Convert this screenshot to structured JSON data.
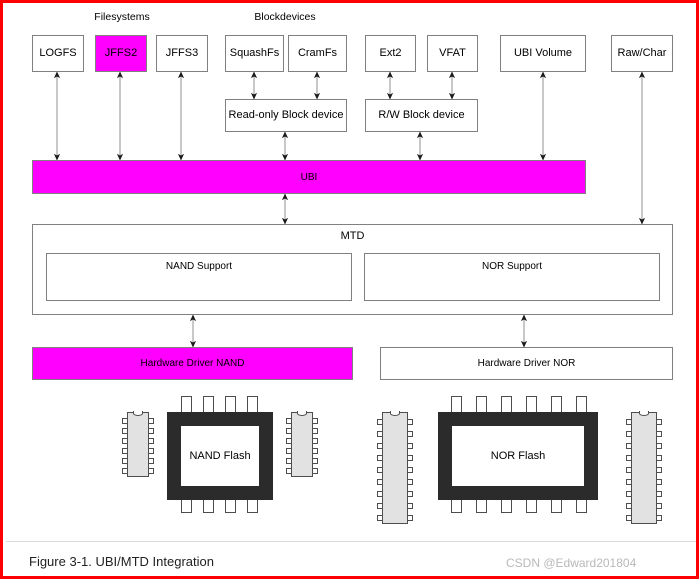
{
  "figure": {
    "caption": "Figure 3-1. UBI/MTD Integration",
    "watermark": "CSDN @Edward201804",
    "border_color": "#ff0000",
    "accent_color": "#ff00ff"
  },
  "group_labels": {
    "filesystems": "Filesystems",
    "blockdevices": "Blockdevices"
  },
  "nodes": {
    "logfs": "LOGFS",
    "jffs2": "JFFS2",
    "jffs3": "JFFS3",
    "squashfs": "SquashFs",
    "cramfs": "CramFs",
    "ext2": "Ext2",
    "vfat": "VFAT",
    "ubi_volume": "UBI Volume",
    "raw_char": "Raw/Char",
    "readonly_block": "Read-only Block device",
    "rw_block": "R/W Block device",
    "ubi": "UBI",
    "mtd": "MTD",
    "nand_support": "NAND Support",
    "nor_support": "NOR Support",
    "hw_driver_nand": "Hardware Driver NAND",
    "hw_driver_nor": "Hardware Driver NOR",
    "nand_flash": "NAND Flash",
    "nor_flash": "NOR Flash"
  }
}
